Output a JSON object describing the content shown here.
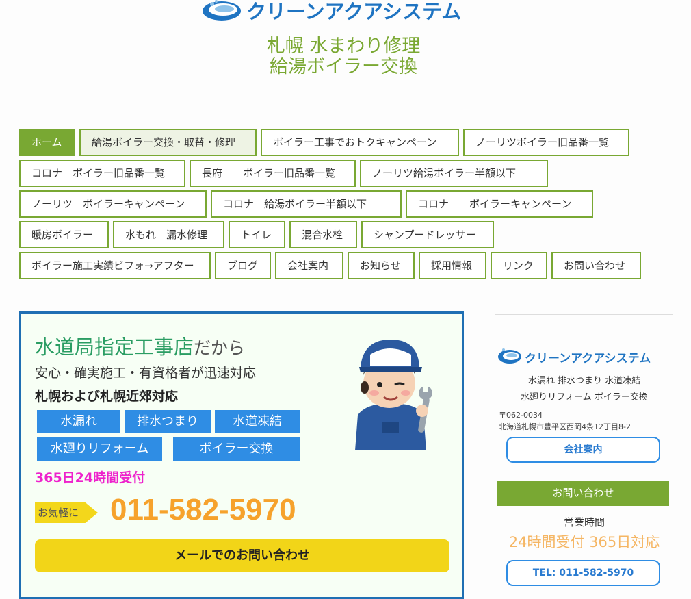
{
  "header": {
    "logo_text": "クリーンアクアシステム",
    "tagline_line1": "札幌 水まわり修理",
    "tagline_line2": "給湯ボイラー交換"
  },
  "nav": {
    "items": [
      {
        "label": "ホーム",
        "active": true
      },
      {
        "label": "給湯ボイラー交換・取替・修理"
      },
      {
        "label": "ボイラー工事でおトクキャンペーン"
      },
      {
        "label": "ノーリツボイラー旧品番一覧"
      },
      {
        "label": "コロナ　ボイラー旧品番一覧"
      },
      {
        "label": "長府　　ボイラー旧品番一覧"
      },
      {
        "label": "ノーリツ給湯ボイラー半額以下"
      },
      {
        "label": "ノーリツ　ボイラーキャンペーン"
      },
      {
        "label": "コロナ　給湯ボイラー半額以下"
      },
      {
        "label": "コロナ　　ボイラーキャンペーン"
      },
      {
        "label": "暖房ボイラー"
      },
      {
        "label": "水もれ　漏水修理"
      },
      {
        "label": "トイレ"
      },
      {
        "label": "混合水栓"
      },
      {
        "label": "シャンプードレッサー"
      },
      {
        "label": "ボイラー施工実績ビフォ→アフター"
      },
      {
        "label": "ブログ"
      },
      {
        "label": "会社案内"
      },
      {
        "label": "お知らせ"
      },
      {
        "label": "採用情報"
      },
      {
        "label": "リンク"
      },
      {
        "label": "お問い合わせ"
      }
    ]
  },
  "main": {
    "title_big": "水道局指定工事店",
    "title_small": "だから",
    "sub1": "安心・確実施工・有資格者が迅速対応",
    "sub2": "札幌および札幌近郊対応",
    "services": [
      "水漏れ",
      "排水つまり",
      "水道凍結",
      "水廻りリフォーム",
      "ボイラー交換"
    ],
    "hours": "365日24時間受付",
    "ribbon": "お気軽に",
    "phone": "011-582-5970",
    "mail_button": "メールでのお問い合わせ"
  },
  "sidebar": {
    "logo_text": "クリーンアクアシステム",
    "line1": "水漏れ 排水つまり 水道凍結",
    "line2": "水廻りリフォーム ボイラー交換",
    "postal": "〒062-0034",
    "address": "北海道札幌市豊平区西岡4条12丁目8-2",
    "company_button": "会社案内",
    "contact_heading": "お問い合わせ",
    "hours_label": "営業時間",
    "hours_value": "24時間受付 365日対応",
    "tel_button": "TEL: 011-582-5970"
  },
  "colors": {
    "accent_green": "#79a833",
    "brand_blue": "#1f74c2",
    "phone_orange": "#f6a22c",
    "cta_yellow": "#f2d518"
  }
}
